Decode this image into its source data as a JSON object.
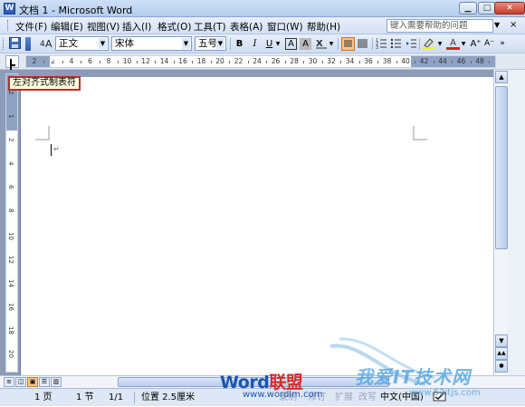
{
  "window": {
    "app_icon": "W",
    "title": "文档 1 - Microsoft Word",
    "controls": [
      "minimize",
      "maximize",
      "close"
    ]
  },
  "menubar": {
    "items": [
      "文件(F)",
      "编辑(E)",
      "视图(V)",
      "插入(I)",
      "格式(O)",
      "工具(T)",
      "表格(A)",
      "窗口(W)",
      "帮助(H)"
    ],
    "help_placeholder": "键入需要帮助的问题",
    "close_glyph": "×"
  },
  "toolbar": {
    "style_value": "正文",
    "font_value": "宋体",
    "size_value": "五号",
    "bold": "B",
    "italic": "I",
    "underline": "U",
    "char_border": "A",
    "char_shading": "A",
    "font_color_glyph": "A",
    "grow_font": "A⁺",
    "shrink_font": "A⁻"
  },
  "ruler": {
    "horizontal_numbers": [
      "2",
      "2",
      "4",
      "6",
      "8",
      "10",
      "12",
      "14",
      "16",
      "18",
      "20",
      "22",
      "24",
      "26",
      "28",
      "30",
      "32",
      "34",
      "36",
      "38",
      "40",
      "42",
      "44",
      "46",
      "48"
    ],
    "vertical_numbers": [
      "2",
      "1",
      "2",
      "4",
      "6",
      "8",
      "10",
      "12",
      "14",
      "16",
      "18",
      "20"
    ]
  },
  "tab_selector": {
    "tooltip": "左对齐式制表符"
  },
  "document": {
    "paragraph_mark": "↵"
  },
  "statusbar": {
    "page": "1 页",
    "section": "1 节",
    "page_count": "1/1",
    "position": "位置 2.5厘米",
    "rec": "录制",
    "trk": "修订",
    "ext": "扩展",
    "ovr": "改写",
    "language": "中文(中国)"
  },
  "watermark": {
    "brand_word": "Word",
    "brand_cn": "联盟",
    "brand_url": "www.wordlm.com",
    "site_cn": "我爱IT技术网",
    "site_url": "www.52itjs.com"
  }
}
